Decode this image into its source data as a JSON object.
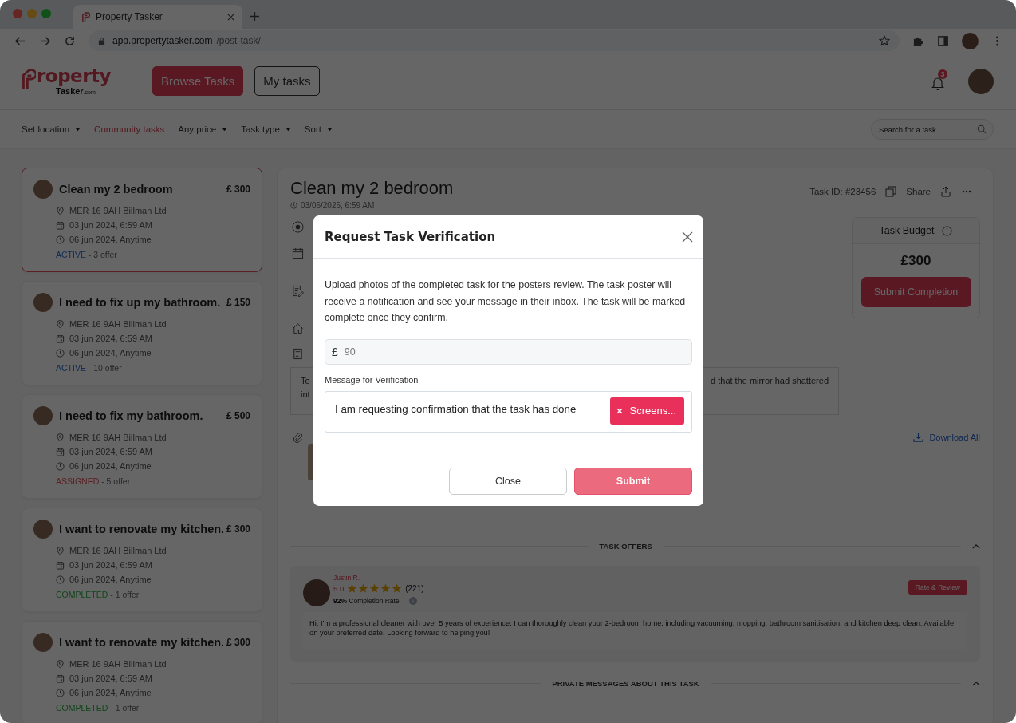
{
  "browser": {
    "tab_title": "Property Tasker",
    "url_host": "app.propertytasker.com",
    "url_path": "/post-task/"
  },
  "header": {
    "logo": {
      "word": "roperty",
      "sub": "Tasker",
      "suffix": ".com"
    },
    "nav_buttons": [
      {
        "label": "Browse Tasks",
        "selected": true
      },
      {
        "label": "My tasks",
        "selected": false
      }
    ],
    "notification_count": "3"
  },
  "filters": [
    {
      "label": "Set location",
      "kind": "dropdown",
      "selected": false
    },
    {
      "label": "Community tasks",
      "kind": "link",
      "selected": true
    },
    {
      "label": "Any price",
      "kind": "dropdown",
      "selected": false
    },
    {
      "label": "Task type",
      "kind": "dropdown",
      "selected": false
    },
    {
      "label": "Sort",
      "kind": "dropdown",
      "selected": false
    }
  ],
  "search": {
    "placeholder": "Search for a task"
  },
  "tasks": [
    {
      "title": "Clean my 2 bedroom",
      "price": "£ 300",
      "location": "MER 16 9AH Billman Ltd",
      "posted": "03 jun 2024, 6:59 AM",
      "due": "06 jun 2024, Anytime",
      "status": "ACTIVE",
      "kind": "active",
      "offers": " - 3 offer",
      "selected": true
    },
    {
      "title": "I need to fix up my bathroom.",
      "price": "£ 150",
      "location": "MER 16 9AH Billman Ltd",
      "posted": "03 jun 2024, 6:59 AM",
      "due": "06 jun 2024, Anytime",
      "status": "ACTIVE",
      "kind": "active",
      "offers": " - 10 offer",
      "selected": false
    },
    {
      "title": "I need to fix my bathroom.",
      "price": "£ 500",
      "location": "MER 16 9AH Billman Ltd",
      "posted": "03 jun 2024, 6:59 AM",
      "due": "06 jun 2024, Anytime",
      "status": "ASSIGNED",
      "kind": "assigned",
      "offers": " - 5 offer",
      "selected": false
    },
    {
      "title": "I want to renovate my kitchen.",
      "price": "£ 300",
      "location": "MER 16 9AH Billman Ltd",
      "posted": "03 jun 2024, 6:59 AM",
      "due": "06 jun 2024, Anytime",
      "status": "COMPLETED",
      "kind": "completed",
      "offers": " - 1 offer",
      "selected": false
    },
    {
      "title": "I want to renovate my kitchen.",
      "price": "£ 300",
      "location": "MER 16 9AH Billman Ltd",
      "posted": "03 jun 2024, 6:59 AM",
      "due": "06 jun 2024, Anytime",
      "status": "COMPLETED",
      "kind": "completed",
      "offers": " - 1 offer",
      "selected": false
    }
  ],
  "detail": {
    "title": "Clean my 2 bedroom",
    "date": "03/06/2026, 6:59 AM",
    "task_id": "Task ID: #23456",
    "share": "Share",
    "fields": [
      {
        "kind": "status"
      },
      {
        "kind": "date"
      },
      {
        "kind": "notes"
      },
      {
        "kind": "property"
      },
      {
        "kind": "description"
      }
    ],
    "description": {
      "left_lines": [
        "To",
        "int"
      ],
      "right_text": "d that the mirror had shattered"
    },
    "attachments": {
      "download": "Download All"
    },
    "budget": {
      "title": "Task Budget",
      "amount": "£300",
      "button": "Submit Completion"
    },
    "offers_section": {
      "heading": "TASK OFFERS",
      "expanded": true
    },
    "offers": [
      {
        "name": "Justin R.",
        "rating": "5.0",
        "stars": 5,
        "reviews": "(221)",
        "completion": "**92%** Completion Rate",
        "action": "Rate & Review",
        "message": "Hi, I’m a professional cleaner with over 5 years of experience. I can thoroughly clean your 2-bedroom home, including vacuuming, mopping, bathroom sanitisation, and kitchen deep clean. Available on your preferred date. Looking forward to helping you!"
      }
    ],
    "messages_section": {
      "heading": "PRIVATE MESSAGES ABOUT THIS TASK",
      "expanded": true
    }
  },
  "modal": {
    "title": "Request Task Verification",
    "description": "Upload photos of the completed task for the posters review. The task poster will receive a notification and see your message in their inbox. The task will be marked complete once they confirm.",
    "amount": {
      "currency": "£",
      "value": "90"
    },
    "message_label": "Message for Verification",
    "message": "I am requesting confirmation that the task has done",
    "attachment": "Screens...",
    "buttons": [
      {
        "label": "Close",
        "kind": "secondary"
      },
      {
        "label": "Submit",
        "kind": "primary"
      }
    ]
  }
}
